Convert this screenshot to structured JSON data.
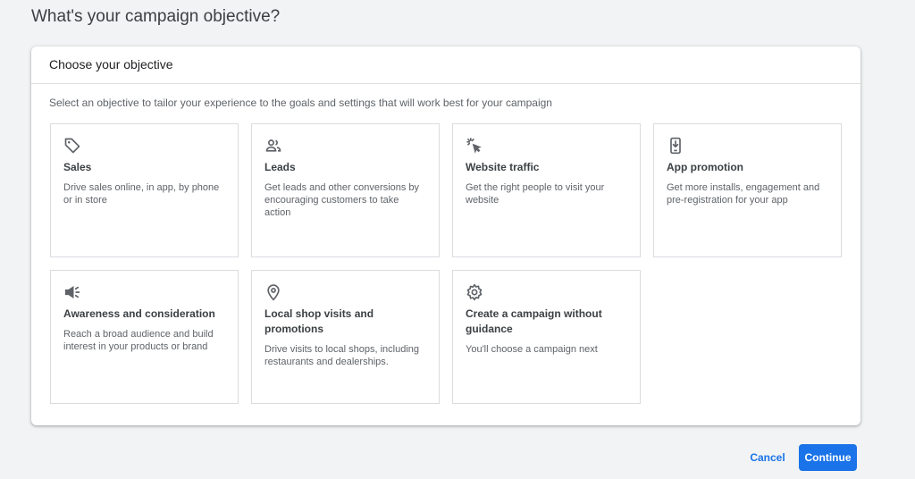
{
  "page": {
    "title": "What's your campaign objective?"
  },
  "card": {
    "header": "Choose your objective",
    "subtitle": "Select an objective to tailor your experience to the goals and settings that will work best for your campaign"
  },
  "objectives": [
    {
      "icon": "tag-icon",
      "title": "Sales",
      "description": "Drive sales online, in app, by phone or in store"
    },
    {
      "icon": "people-icon",
      "title": "Leads",
      "description": "Get leads and other conversions by encouraging customers to take action"
    },
    {
      "icon": "cursor-click-icon",
      "title": "Website traffic",
      "description": "Get the right people to visit your website"
    },
    {
      "icon": "phone-download-icon",
      "title": "App promotion",
      "description": "Get more installs, engagement and pre-registration for your app"
    },
    {
      "icon": "megaphone-icon",
      "title": "Awareness and consideration",
      "description": "Reach a broad audience and build interest in your products or brand"
    },
    {
      "icon": "location-pin-icon",
      "title": "Local shop visits and promotions",
      "description": "Drive visits to local shops, including restaurants and dealerships."
    },
    {
      "icon": "gear-icon",
      "title": "Create a campaign without guidance",
      "description": "You'll choose a campaign next"
    }
  ],
  "footer": {
    "cancel_label": "Cancel",
    "continue_label": "Continue"
  },
  "colors": {
    "accent": "#1a73e8",
    "icon": "#5f6368",
    "background": "#f1f3f4"
  }
}
